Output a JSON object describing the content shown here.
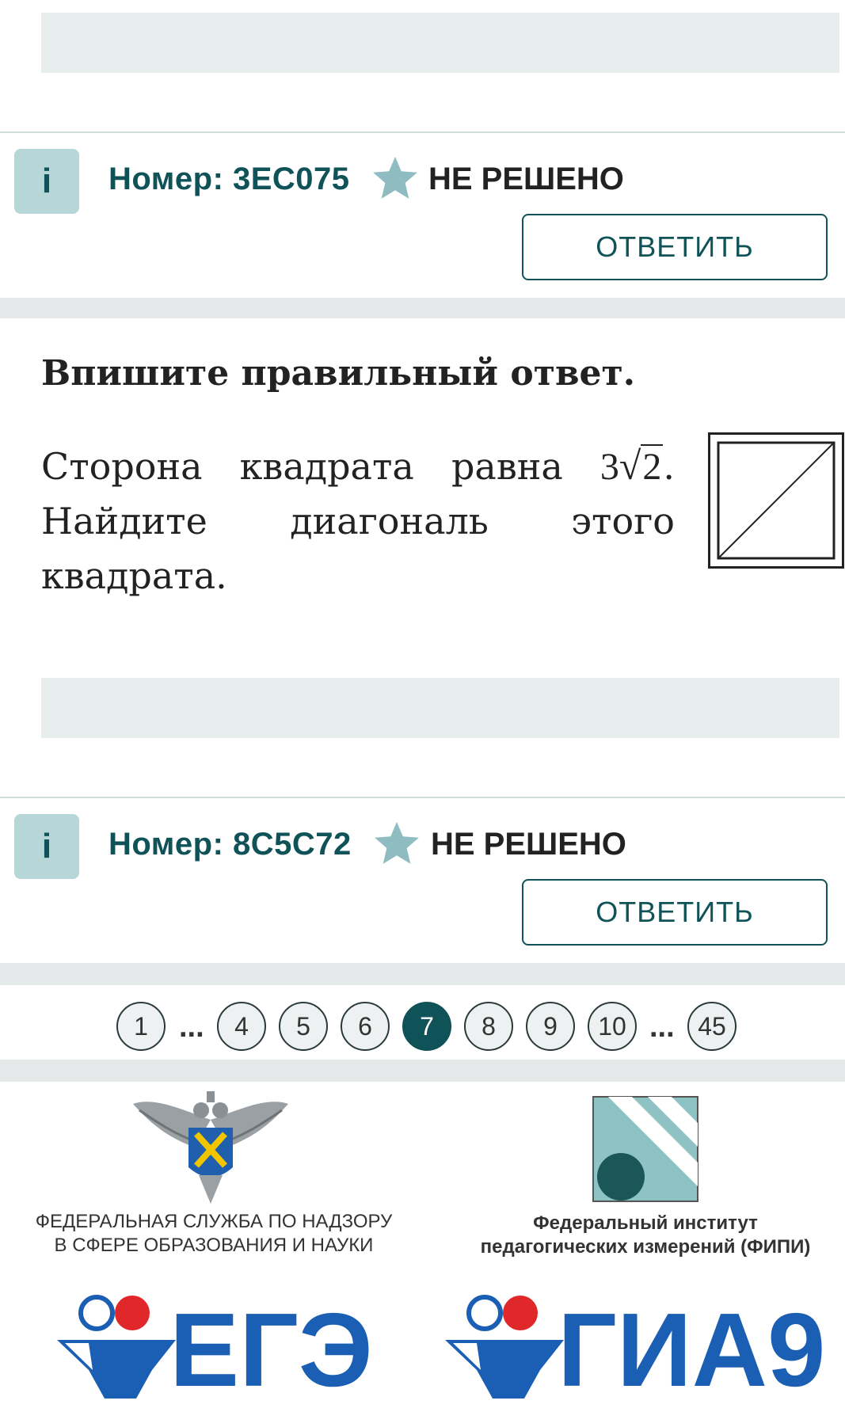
{
  "colors": {
    "accent": "#0f5257",
    "info_bg": "#b7d6d7",
    "star": "#8fbcc0",
    "band": "#e5e9e9"
  },
  "tasks": [
    {
      "info_label": "i",
      "number": "Номер: 3EC075",
      "status": "НЕ РЕШЕНО",
      "answer_label": "ОТВЕТИТЬ"
    },
    {
      "info_label": "i",
      "number": "Номер: 8C5C72",
      "status": "НЕ РЕШЕНО",
      "answer_label": "ОТВЕТИТЬ"
    }
  ],
  "problem": {
    "instruction": "Впишите правильный ответ.",
    "text_before": "Сторона квадрата равна ",
    "math_coef": "3",
    "math_radicand": "2",
    "text_after": ". Найдите диагональ этого квадрата."
  },
  "pagination": {
    "pages": [
      "1",
      "4",
      "5",
      "6",
      "7",
      "8",
      "9",
      "10",
      "45"
    ],
    "ellipsis": "...",
    "active": "7"
  },
  "footer": {
    "rosobr_caption_1": "ФЕДЕРАЛЬНАЯ СЛУЖБА ПО НАДЗОРУ",
    "rosobr_caption_2": "В СФЕРЕ ОБРАЗОВАНИЯ И НАУКИ",
    "fipi_caption_1": "Федеральный институт",
    "fipi_caption_2": "педагогических измерений (ФИПИ)",
    "ege_logo": "ЕГЭ",
    "gia_logo": "ГИА9"
  }
}
